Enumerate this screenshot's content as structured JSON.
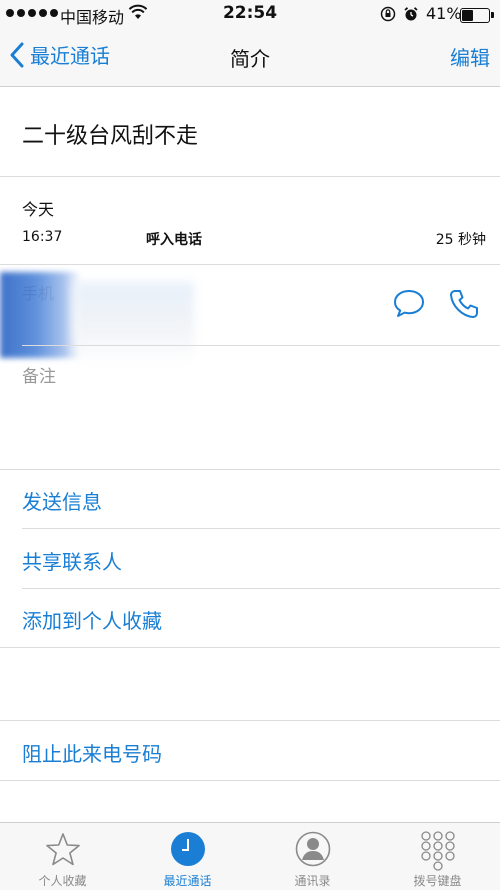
{
  "status_bar": {
    "carrier": "中国移动",
    "time": "22:54",
    "battery": "41%",
    "battery_level": 0.41
  },
  "nav": {
    "back_label": "最近通话",
    "title": "简介",
    "edit_label": "编辑"
  },
  "contact": {
    "name": "二十级台风刮不走"
  },
  "call_log": {
    "date": "今天",
    "time": "16:37",
    "type": "呼入电话",
    "duration": "25 秒钟"
  },
  "phone": {
    "label": "手机"
  },
  "notes": {
    "label": "备注"
  },
  "actions": {
    "send_message": "发送信息",
    "share_contact": "共享联系人",
    "add_favorite": "添加到个人收藏",
    "block_caller": "阻止此来电号码"
  },
  "tabs": [
    {
      "label": "个人收藏",
      "icon": "star-icon"
    },
    {
      "label": "最近通话",
      "icon": "clock-icon",
      "active": true
    },
    {
      "label": "通讯录",
      "icon": "contacts-icon"
    },
    {
      "label": "拨号键盘",
      "icon": "keypad-icon"
    }
  ],
  "colors": {
    "accent": "#1a7fd4",
    "bar_background": "#f7f7f7"
  }
}
